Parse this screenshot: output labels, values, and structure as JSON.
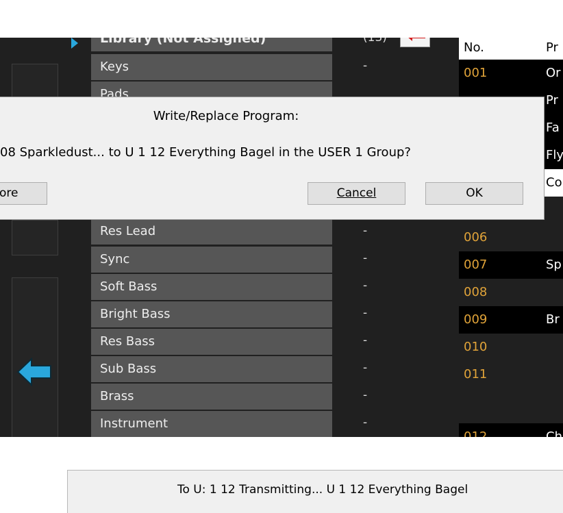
{
  "library_header": {
    "label": "Library (Not Assigned)",
    "count": "(13)"
  },
  "categories": [
    {
      "label": "Keys",
      "count": "-"
    },
    {
      "label": "Pads",
      "count": ""
    },
    {
      "label": "Res Lead",
      "count": "-"
    },
    {
      "label": "Sync",
      "count": "-"
    },
    {
      "label": "Soft Bass",
      "count": "-"
    },
    {
      "label": "Bright Bass",
      "count": "-"
    },
    {
      "label": "Res Bass",
      "count": "-"
    },
    {
      "label": "Sub Bass",
      "count": "-"
    },
    {
      "label": "Brass",
      "count": "-"
    },
    {
      "label": "Instrument",
      "count": "-"
    }
  ],
  "program_list": {
    "col_no": "No.",
    "col_name": "Pr",
    "rows": [
      {
        "num": "001",
        "name": "Or",
        "style": "dark"
      },
      {
        "num": "",
        "name": "Pr",
        "style": "dark"
      },
      {
        "num": "",
        "name": "Fa",
        "style": "dark"
      },
      {
        "num": "",
        "name": "Fly",
        "style": "dark"
      },
      {
        "num": "",
        "name": "Co",
        "style": "sel"
      },
      {
        "num": "006",
        "name": "",
        "style": "none"
      },
      {
        "num": "007",
        "name": "Sp",
        "style": "dark"
      },
      {
        "num": "008",
        "name": "",
        "style": "none"
      },
      {
        "num": "009",
        "name": "Br",
        "style": "dark"
      },
      {
        "num": "010",
        "name": "",
        "style": "none"
      },
      {
        "num": "011",
        "name": "",
        "style": "none"
      },
      {
        "num": "012",
        "name": "Ch",
        "style": "dark"
      }
    ]
  },
  "dialog": {
    "title": "Write/Replace Program:",
    "message": "08  Sparkledust... to U 1 12  Everything Bagel in the USER 1 Group?",
    "left_button": "ore",
    "cancel_button": "Cancel",
    "ok_button": "OK"
  },
  "status": {
    "text": "To U:  1  12  Transmitting... U 1 12  Everything Bagel"
  },
  "colors": {
    "number_accent": "#e0a339",
    "arrow_blue": "#2aa7dc",
    "panel_bg": "#202020",
    "dialog_bg": "#f0f0f0"
  }
}
